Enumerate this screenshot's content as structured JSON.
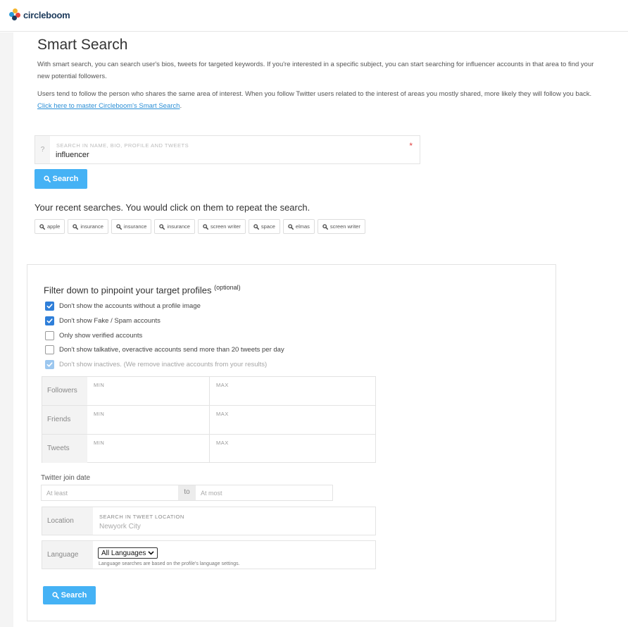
{
  "brand": {
    "name": "circleboom",
    "colors": {
      "primary_button": "#45b2f5",
      "link": "#2b8fd6",
      "checkbox": "#2f7fd9"
    }
  },
  "page": {
    "title": "Smart Search",
    "intro_1": "With smart search, you can search user's bios, tweets for targeted keywords. If you're interested in a specific subject, you can start searching for influencer accounts in that area to find your new potential followers.",
    "intro_2": "Users tend to follow the person who shares the same area of interest. When you follow Twitter users related to the interest of areas you mostly shared, more likely they will follow you back.",
    "intro_link": "Click here to master Circleboom's Smart Search",
    "intro_link_suffix": "."
  },
  "search": {
    "help_icon": "?",
    "label": "SEARCH IN NAME, BIO, PROFILE AND TWEETS",
    "required_mark": "*",
    "value": "influencer",
    "button_label": "Search",
    "button_icon": "search-icon"
  },
  "recent": {
    "title": "Your recent searches. You would click on them to repeat the search.",
    "items": [
      "apple",
      "insurance",
      "insurance",
      "insurance",
      "screen writer",
      "space",
      "elmas",
      "screen writer"
    ]
  },
  "filters": {
    "title": "Filter down to pinpoint your target profiles",
    "title_note": "(optional)",
    "checkboxes": [
      {
        "label": "Don't show the accounts without a profile image",
        "checked": true,
        "disabled": false
      },
      {
        "label": "Don't show Fake / Spam accounts",
        "checked": true,
        "disabled": false
      },
      {
        "label": "Only show verified accounts",
        "checked": false,
        "disabled": false
      },
      {
        "label": "Don't show talkative, overactive accounts send more than 20 tweets per day",
        "checked": false,
        "disabled": false
      },
      {
        "label": "Don't show inactives. (We remove inactive accounts from your results)",
        "checked": true,
        "disabled": true
      }
    ],
    "ranges": [
      {
        "label": "Followers",
        "min_label": "MIN",
        "max_label": "MAX"
      },
      {
        "label": "Friends",
        "min_label": "MIN",
        "max_label": "MAX"
      },
      {
        "label": "Tweets",
        "min_label": "MIN",
        "max_label": "MAX"
      }
    ],
    "join_date": {
      "label": "Twitter join date",
      "from_placeholder": "At least",
      "separator": "to",
      "to_placeholder": "At most"
    },
    "location": {
      "label": "Location",
      "mini_label": "SEARCH IN TWEET LOCATION",
      "placeholder": "Newyork City"
    },
    "language": {
      "label": "Language",
      "selected": "All Languages",
      "note": "Language searches are based on the profile's language settings."
    },
    "button_label": "Search"
  }
}
